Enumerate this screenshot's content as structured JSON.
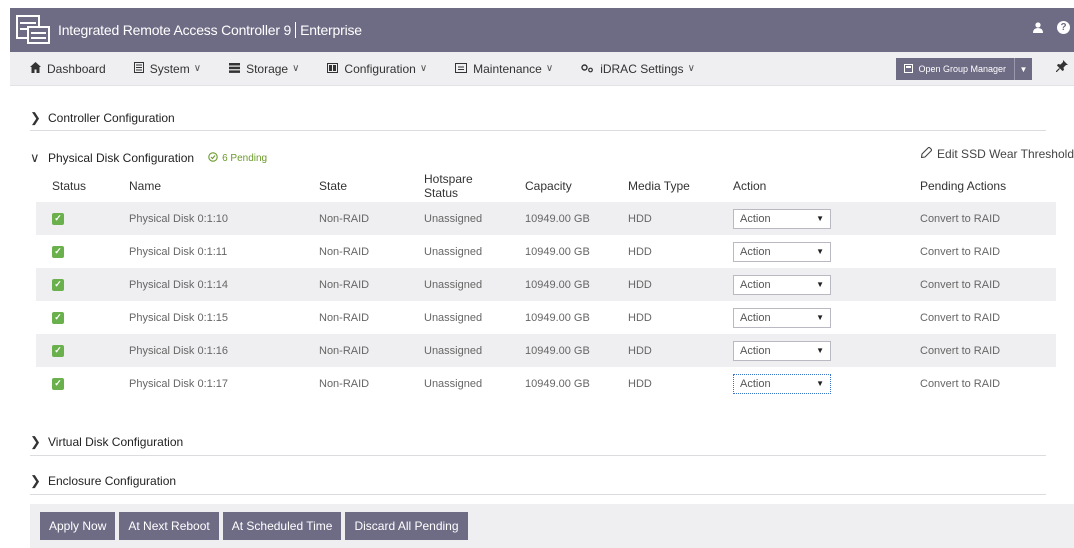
{
  "header": {
    "title_main": "Integrated Remote Access Controller 9",
    "title_edition": "Enterprise",
    "icons": [
      "server-icon",
      "user-icon",
      "help-icon"
    ],
    "help_glyph": "?"
  },
  "nav": {
    "items": [
      {
        "label": "Dashboard",
        "icon": "home-icon",
        "dropdown": false
      },
      {
        "label": "System",
        "icon": "system-icon",
        "dropdown": true
      },
      {
        "label": "Storage",
        "icon": "storage-icon",
        "dropdown": true
      },
      {
        "label": "Configuration",
        "icon": "configuration-icon",
        "dropdown": true
      },
      {
        "label": "Maintenance",
        "icon": "maintenance-icon",
        "dropdown": true
      },
      {
        "label": "iDRAC Settings",
        "icon": "idrac-settings-icon",
        "dropdown": true
      }
    ],
    "group_manager_label": "Open Group Manager"
  },
  "sections": {
    "controller": "Controller Configuration",
    "physical_disk": "Physical Disk Configuration",
    "pending_label": "6 Pending",
    "edit_ssd": "Edit SSD Wear Threshold",
    "virtual_disk": "Virtual Disk Configuration",
    "enclosure": "Enclosure Configuration"
  },
  "table": {
    "headers": [
      "Status",
      "Name",
      "State",
      "Hotspare Status",
      "Capacity",
      "Media Type",
      "Action",
      "Pending Actions"
    ],
    "rows": [
      {
        "name": "Physical Disk 0:1:10",
        "state": "Non-RAID",
        "hotspare": "Unassigned",
        "capacity": "10949.00 GB",
        "media": "HDD",
        "action": "Action",
        "pending": "Convert to RAID"
      },
      {
        "name": "Physical Disk 0:1:11",
        "state": "Non-RAID",
        "hotspare": "Unassigned",
        "capacity": "10949.00 GB",
        "media": "HDD",
        "action": "Action",
        "pending": "Convert to RAID"
      },
      {
        "name": "Physical Disk 0:1:14",
        "state": "Non-RAID",
        "hotspare": "Unassigned",
        "capacity": "10949.00 GB",
        "media": "HDD",
        "action": "Action",
        "pending": "Convert to RAID"
      },
      {
        "name": "Physical Disk 0:1:15",
        "state": "Non-RAID",
        "hotspare": "Unassigned",
        "capacity": "10949.00 GB",
        "media": "HDD",
        "action": "Action",
        "pending": "Convert to RAID"
      },
      {
        "name": "Physical Disk 0:1:16",
        "state": "Non-RAID",
        "hotspare": "Unassigned",
        "capacity": "10949.00 GB",
        "media": "HDD",
        "action": "Action",
        "pending": "Convert to RAID"
      },
      {
        "name": "Physical Disk 0:1:17",
        "state": "Non-RAID",
        "hotspare": "Unassigned",
        "capacity": "10949.00 GB",
        "media": "HDD",
        "action": "Action",
        "pending": "Convert to RAID"
      }
    ]
  },
  "footer": {
    "apply_now": "Apply Now",
    "next_reboot": "At Next Reboot",
    "scheduled": "At Scheduled Time",
    "discard": "Discard All Pending"
  },
  "colors": {
    "header_bg": "#6e6b85",
    "nav_bg": "#efeff1",
    "status_ok": "#6ab04c",
    "pending_green": "#6b9a2a"
  }
}
